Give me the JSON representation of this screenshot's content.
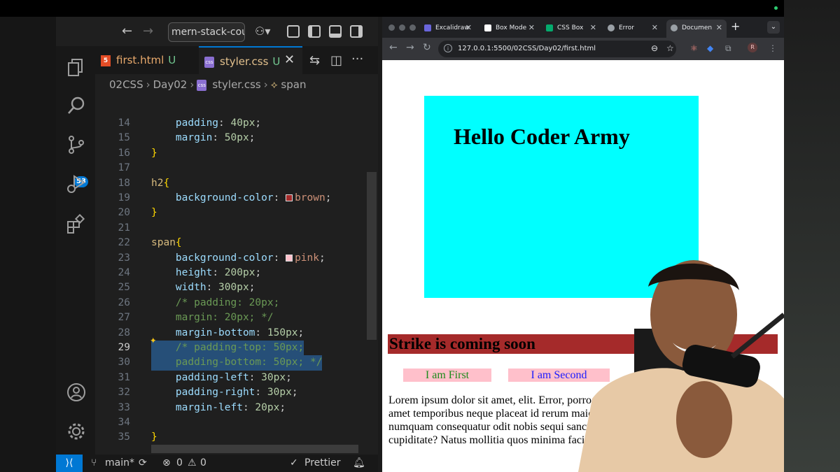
{
  "vscode": {
    "search_box": "mern-stack-cou",
    "tabs": [
      {
        "name": "first.html",
        "status": "U"
      },
      {
        "name": "styler.css",
        "status": "U"
      }
    ],
    "breadcrumb": [
      "02CSS",
      "Day02",
      "styler.css",
      "span"
    ],
    "scm_badge": "53",
    "code_lines": [
      {
        "n": "14",
        "text": "    padding: 40px;"
      },
      {
        "n": "15",
        "text": "    margin: 50px;"
      },
      {
        "n": "16",
        "text": "}"
      },
      {
        "n": "17",
        "text": ""
      },
      {
        "n": "18",
        "text": "h2{"
      },
      {
        "n": "19",
        "text": "    background-color: brown;"
      },
      {
        "n": "20",
        "text": "}"
      },
      {
        "n": "21",
        "text": ""
      },
      {
        "n": "22",
        "text": "span{"
      },
      {
        "n": "23",
        "text": "    background-color: pink;"
      },
      {
        "n": "24",
        "text": "    height: 200px;"
      },
      {
        "n": "25",
        "text": "    width: 300px;"
      },
      {
        "n": "26",
        "text": "    /* padding: 20px;"
      },
      {
        "n": "27",
        "text": "    margin: 20px; */"
      },
      {
        "n": "28",
        "text": "    margin-bottom: 150px;"
      },
      {
        "n": "29",
        "text": "    /* padding-top: 50px;"
      },
      {
        "n": "30",
        "text": "    padding-bottom: 50px; */"
      },
      {
        "n": "31",
        "text": "    padding-left: 30px;"
      },
      {
        "n": "32",
        "text": "    padding-right: 30px;"
      },
      {
        "n": "33",
        "text": "    margin-left: 20px;"
      },
      {
        "n": "34",
        "text": ""
      },
      {
        "n": "35",
        "text": "}"
      }
    ],
    "status": {
      "branch": "main*",
      "errors": "0",
      "warnings": "0",
      "formatter": "Prettier"
    }
  },
  "chrome": {
    "tabs": [
      "Excalidraw",
      "Box Mode",
      "CSS Box",
      "Error",
      "Documen"
    ],
    "url": "127.0.0.1:5500/02CSS/Day02/first.html",
    "profile": "R",
    "page": {
      "h1": "Hello Coder Army",
      "h2": "Strike is coming soon",
      "span1": "I am First",
      "span2": "I am Second",
      "paragraph": "Lorem ipsum dolor sit amet, elit. Error, porro, beatae culpa officiis facere laborum amet temporibus neque placeat id rerum maiores. Veniet consequuntur, iure dolores numquam consequatur odit nobis sequi sanctium animi rerum corrupti eos, optio cupiditate? Natus mollitia quos minima facilis ullam?"
    }
  },
  "colors": {
    "h1_bg": "#00ffff",
    "h2_bg": "#a52a2a",
    "span_bg": "#ffc0cb",
    "accent": "#0078d4"
  }
}
